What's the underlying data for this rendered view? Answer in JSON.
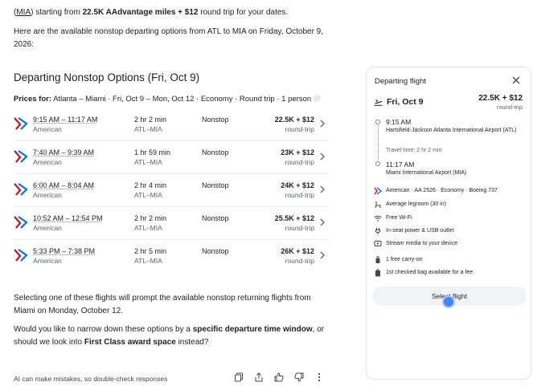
{
  "chat": {
    "intro": {
      "airport_code": "MIA",
      "text_a": ") starting from ",
      "miles": "22.5K AAdvantage miles + $12",
      "text_b": " round trip for your dates."
    },
    "available_text": "Here are the available nonstop departing options from ATL to MIA on Friday, October 9, 2026:",
    "options_title": "Departing Nonstop Options (Fri, Oct 9)",
    "prices_label": "Prices for:",
    "prices_detail": "Atlanta – Miami · Fri, Oct 9 – Mon, Oct 12 · Economy · Round trip · 1 person",
    "flights": [
      {
        "time": "9:15 AM – 11:17 AM",
        "airline": "American",
        "duration": "2 hr 2 min",
        "route": "ATL–MIA",
        "stops": "Nonstop",
        "price": "22.5K + $12",
        "price_sub": "round-trip"
      },
      {
        "time": "7:40 AM – 9:39 AM",
        "airline": "American",
        "duration": "1 hr 59 min",
        "route": "ATL–MIA",
        "stops": "Nonstop",
        "price": "23K + $12",
        "price_sub": "round-trip"
      },
      {
        "time": "6:00 AM – 8:04 AM",
        "airline": "American",
        "duration": "2 hr 4 min",
        "route": "ATL–MIA",
        "stops": "Nonstop",
        "price": "24K + $12",
        "price_sub": "round-trip"
      },
      {
        "time": "10:52 AM – 12:54 PM",
        "airline": "American",
        "duration": "2 hr 2 min",
        "route": "ATL–MIA",
        "stops": "Nonstop",
        "price": "25.5K + $12",
        "price_sub": "round-trip"
      },
      {
        "time": "5:33 PM – 7:38 PM",
        "airline": "American",
        "duration": "2 hr 5 min",
        "route": "ATL–MIA",
        "stops": "Nonstop",
        "price": "26K + $12",
        "price_sub": "round-trip"
      }
    ],
    "selecting_text": "Selecting one of these flights will prompt the available nonstop returning flights from Miami on Monday, October 12.",
    "question": {
      "a": "Would you like to narrow down these options by a ",
      "b": "specific departure time window",
      "c": ", or should we look into ",
      "d": "First Class award space",
      "e": " instead?"
    },
    "disclaimer": "AI can make mistakes, so double-check responses",
    "action_icons": [
      "copy-icon",
      "share-icon",
      "thumbs-up-icon",
      "thumbs-down-icon",
      "more-vert-icon"
    ]
  },
  "detail": {
    "title": "Departing flight",
    "date": "Fri, Oct 9",
    "price": "22.5K + $12",
    "price_sub": "round-trip",
    "depart_time": "9:15 AM",
    "depart_airport": "Hartsfield-Jackson Atlanta International Airport (ATL)",
    "travel_time": "Travel time: 2 hr 2 min",
    "arrive_time": "11:17 AM",
    "arrive_airport": "Miami International Airport (MIA)",
    "amenities": [
      {
        "icon": "airline-icon",
        "text": "American · AA 2526 · Economy · Boeing 737"
      },
      {
        "icon": "legroom-icon",
        "text": "Average legroom (30 in)"
      },
      {
        "icon": "wifi-icon",
        "text": "Free Wi-Fi"
      },
      {
        "icon": "power-icon",
        "text": "In-seat power & USB outlet"
      },
      {
        "icon": "media-icon",
        "text": "Stream media to your device"
      },
      {
        "icon": "carry-on-icon",
        "text": "1 free carry-on"
      },
      {
        "icon": "checked-bag-icon",
        "text": "1st checked bag available for a fee"
      }
    ],
    "select_label": "Select flight"
  },
  "colors": {
    "aa_red": "#c8102e",
    "aa_blue": "#0078d2",
    "cursor": "#4285f4"
  }
}
